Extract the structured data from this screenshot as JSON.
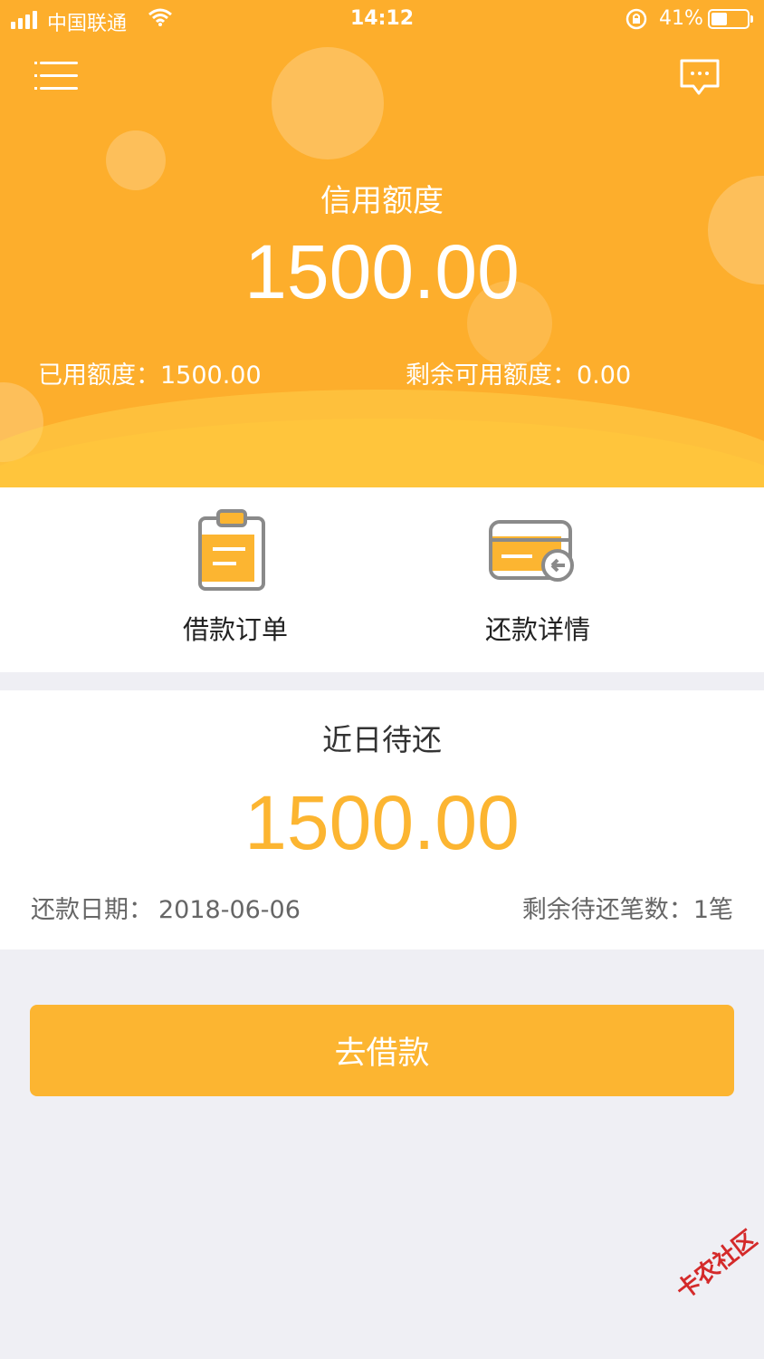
{
  "status_bar": {
    "carrier": "中国联通",
    "time": "14:12",
    "battery": "41%"
  },
  "header": {
    "credit_title": "信用额度",
    "credit_amount": "1500.00",
    "used_label": "已用额度：1500.00",
    "remaining_label": "剩余可用额度：0.00"
  },
  "actions": [
    {
      "label": "借款订单",
      "icon": "clipboard-icon"
    },
    {
      "label": "还款详情",
      "icon": "card-return-icon"
    }
  ],
  "repayment": {
    "title": "近日待还",
    "amount": "1500.00",
    "date_label": "还款日期：",
    "date_value": "2018-06-06",
    "count_label": "剩余待还笔数：",
    "count_value": "1笔"
  },
  "borrow_button": "去借款",
  "watermark": "卡农社区",
  "colors": {
    "brand": "#fdae2c",
    "accent": "#fcb531",
    "background": "#efeff4"
  }
}
